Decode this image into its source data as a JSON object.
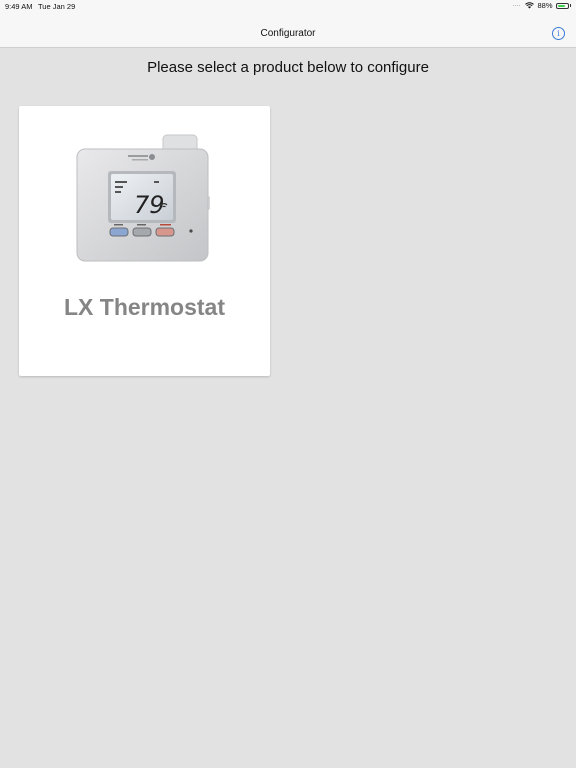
{
  "status_bar": {
    "time": "9:49 AM",
    "date": "Tue Jan 29",
    "battery": "88%",
    "battery_level": 0.88,
    "icons": [
      "cellular-dots-icon",
      "wifi-icon",
      "battery-icon"
    ]
  },
  "nav": {
    "title": "Configurator",
    "info_icon": "info-icon",
    "info_symbol": "i",
    "accent_color": "#3a7ad9"
  },
  "main": {
    "heading": "Please select a product below to configure",
    "products": [
      {
        "name": "LX Thermostat",
        "display_temp": "79",
        "image_icon": "thermostat-icon"
      }
    ]
  }
}
